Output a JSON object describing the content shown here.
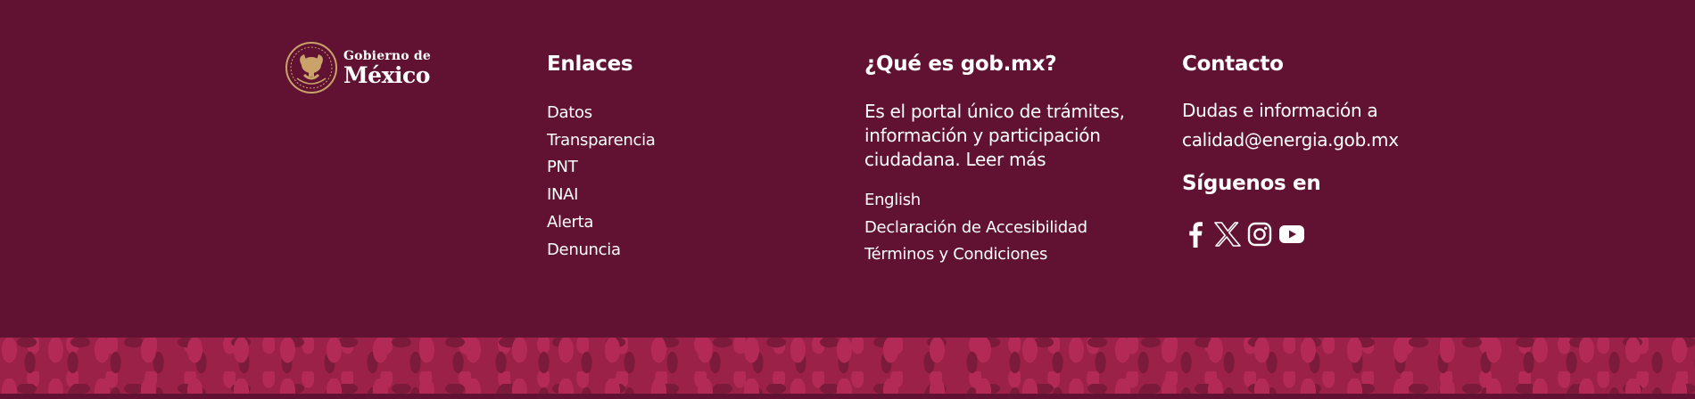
{
  "logo": {
    "line1": "Gobierno de",
    "line2": "México"
  },
  "links": {
    "title": "Enlaces",
    "items": [
      "Datos",
      "Transparencia",
      "PNT",
      "INAI",
      "Alerta",
      "Denuncia"
    ]
  },
  "about": {
    "title": "¿Qué es gob.mx?",
    "text": "Es el portal único de trámites, información y participación ciudadana.",
    "read_more": "Leer más",
    "items": [
      "English",
      "Declaración de Accesibilidad",
      "Términos y Condiciones"
    ]
  },
  "contact": {
    "title": "Contacto",
    "text": "Dudas e información a",
    "email": "calidad@energia.gob.mx",
    "follow_title": "Síguenos en",
    "social": [
      "facebook-icon",
      "x-icon",
      "instagram-icon",
      "youtube-icon"
    ]
  },
  "colors": {
    "background": "#611232",
    "pattern": "#9b2148",
    "seal": "#c9a36a"
  }
}
